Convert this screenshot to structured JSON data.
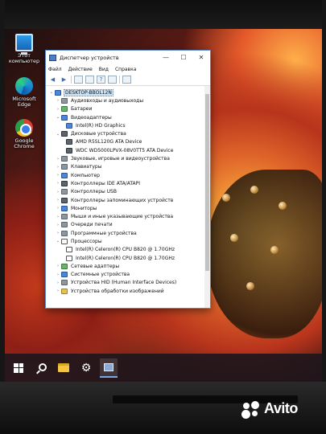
{
  "desktop": {
    "icons": [
      {
        "label": "Этот компьютер",
        "icon": "this-pc-icon"
      },
      {
        "label": "Microsoft Edge",
        "icon": "edge-icon"
      },
      {
        "label": "Google Chrome",
        "icon": "chrome-icon"
      }
    ]
  },
  "window": {
    "title": "Диспетчер устройств",
    "menu": [
      "Файл",
      "Действие",
      "Вид",
      "Справка"
    ],
    "controls": {
      "minimize": "—",
      "maximize": "☐",
      "close": "✕"
    },
    "tree": {
      "root": "DESKTOP-BBOL12N",
      "categories": [
        {
          "label": "Аудиовходы и аудиовыходы",
          "expanded": false
        },
        {
          "label": "Батареи",
          "expanded": false
        },
        {
          "label": "Видеоадаптеры",
          "expanded": true,
          "children": [
            "Intel(R) HD Graphics"
          ]
        },
        {
          "label": "Дисковые устройства",
          "expanded": true,
          "children": [
            "AMD R5SL120G ATA Device",
            "WDC WD5000LPVX-08V0TT5 ATA Device"
          ]
        },
        {
          "label": "Звуковые, игровые и видеоустройства",
          "expanded": false
        },
        {
          "label": "Клавиатуры",
          "expanded": false
        },
        {
          "label": "Компьютер",
          "expanded": false
        },
        {
          "label": "Контроллеры IDE ATA/ATAPI",
          "expanded": false
        },
        {
          "label": "Контроллеры USB",
          "expanded": false
        },
        {
          "label": "Контроллеры запоминающих устройств",
          "expanded": false
        },
        {
          "label": "Мониторы",
          "expanded": false
        },
        {
          "label": "Мыши и иные указывающие устройства",
          "expanded": false
        },
        {
          "label": "Очереди печати",
          "expanded": false
        },
        {
          "label": "Программные устройства",
          "expanded": false
        },
        {
          "label": "Процессоры",
          "expanded": true,
          "children": [
            "Intel(R) Celeron(R) CPU B820 @ 1.70GHz",
            "Intel(R) Celeron(R) CPU B820 @ 1.70GHz"
          ]
        },
        {
          "label": "Сетевые адаптеры",
          "expanded": false
        },
        {
          "label": "Системные устройства",
          "expanded": false
        },
        {
          "label": "Устройства HID (Human Interface Devices)",
          "expanded": false
        },
        {
          "label": "Устройства обработки изображений",
          "expanded": false
        }
      ]
    }
  },
  "taskbar": {
    "items": [
      "start-icon",
      "search-icon",
      "file-explorer-icon",
      "settings-icon",
      "device-manager-icon"
    ]
  },
  "watermark": {
    "text": "Avito"
  }
}
